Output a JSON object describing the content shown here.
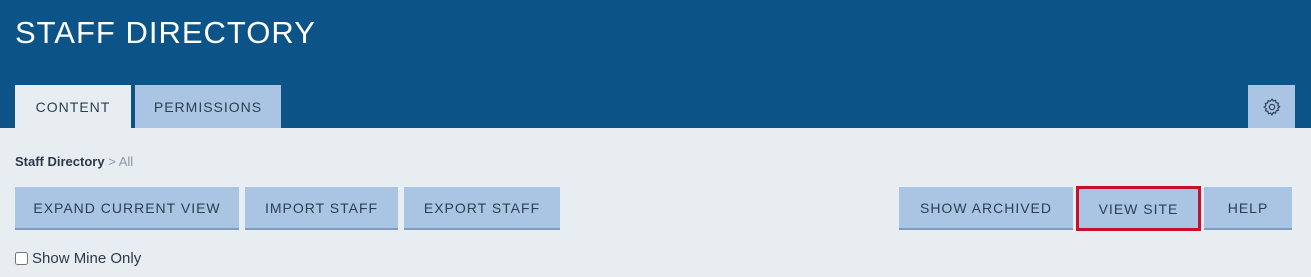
{
  "header": {
    "title": "STAFF DIRECTORY"
  },
  "tabs": [
    {
      "label": "CONTENT",
      "active": true
    },
    {
      "label": "PERMISSIONS",
      "active": false
    }
  ],
  "settings": {
    "icon": "gear-icon"
  },
  "breadcrumb": {
    "root": "Staff Directory",
    "separator": ">",
    "current": "All"
  },
  "toolbar": {
    "expand_label": "EXPAND CURRENT VIEW",
    "import_label": "IMPORT STAFF",
    "export_label": "EXPORT STAFF",
    "archived_label": "SHOW ARCHIVED",
    "viewsite_label": "VIEW SITE",
    "help_label": "HELP"
  },
  "filter": {
    "show_mine_label": "Show Mine Only",
    "checked": false
  },
  "colors": {
    "header_bg": "#0c5487",
    "button_bg": "#a9c5e3",
    "page_bg": "#e8edf2",
    "highlight": "#c8102e"
  }
}
